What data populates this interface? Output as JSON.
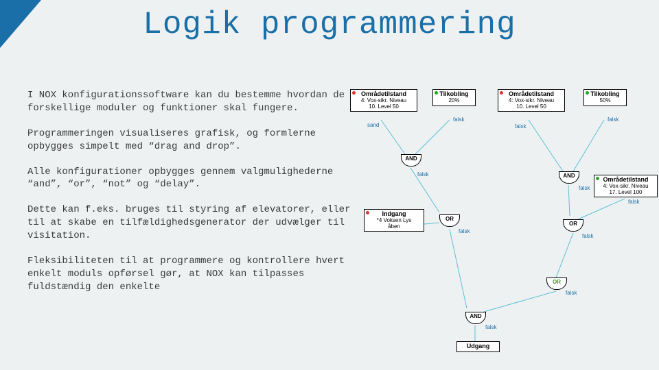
{
  "title": "Logik programmering",
  "paragraphs": {
    "p1": "I NOX konfigurationssoftware kan du bestemme hvordan de forskellige moduler og funktioner skal fungere.",
    "p2": "Programmeringen visualiseres grafisk, og formlerne opbygges simpelt med “drag and drop”.",
    "p3": "Alle konfigurationer opbygges gennem valgmulighederne “and”, “or”, “not” og “delay”.",
    "p4": "Dette kan f.eks. bruges til styring af elevatorer, eller til at skabe en tilfældighedsgenerator der udvælger til visitation.",
    "p5": "Fleksibiliteten til at programmere og kontrollere hvert enkelt moduls opførsel gør, at NOX kan tilpasses fuldstændig den enkelte"
  },
  "diagram": {
    "topBoxes": {
      "b1": {
        "title": "Områdetilstand",
        "l1": "4: Vox-sikr. Niveau",
        "l2": "10. Level 50"
      },
      "b2": {
        "title": "Tilkobling",
        "l1": "20%"
      },
      "b3": {
        "title": "Områdetilstand",
        "l1": "4: Vox-sikr. Niveau",
        "l2": "10. Level 50"
      },
      "b4": {
        "title": "Tilkobling",
        "l1": "50%"
      }
    },
    "midBox": {
      "title": "Indgang",
      "l1": "*4 Voksen Lys",
      "l2": "åben"
    },
    "rightBox": {
      "title": "Områdetilstand",
      "l1": "4: Vox-sikr. Niveau",
      "l2": "17. Level 100"
    },
    "bottomBox": {
      "title": "Udgang"
    },
    "gates": {
      "and": "AND",
      "or": "OR"
    },
    "wireLabel1": "sand",
    "wireLabel2": "falsk"
  }
}
